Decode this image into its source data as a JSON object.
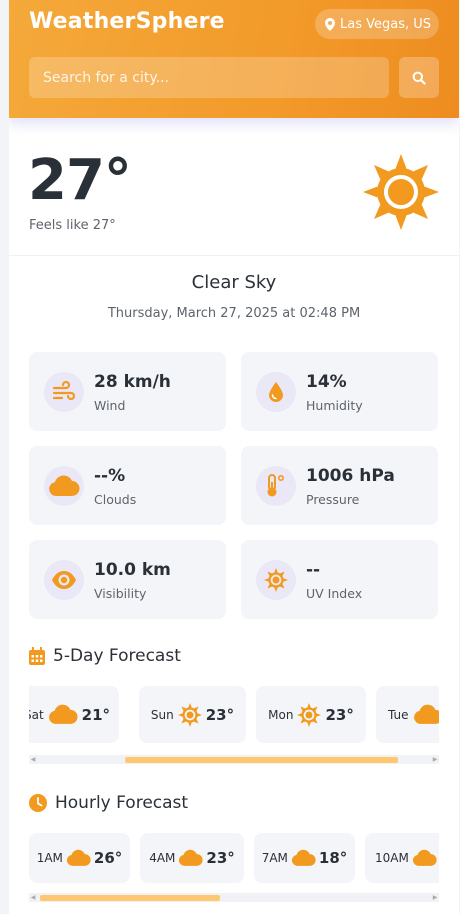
{
  "header": {
    "app_title": "WeatherSphere",
    "location": "Las Vegas, US",
    "search_placeholder": "Search for a city..."
  },
  "current": {
    "temperature": "27°",
    "feels_like": "Feels like 27°",
    "condition": "Clear Sky",
    "datetime": "Thursday, March 27, 2025 at 02:48 PM",
    "icon": "sun-icon"
  },
  "stats": [
    {
      "value": "28 km/h",
      "label": "Wind",
      "icon": "wind-icon"
    },
    {
      "value": "14%",
      "label": "Humidity",
      "icon": "droplet-icon"
    },
    {
      "value": "--%",
      "label": "Clouds",
      "icon": "cloud-icon"
    },
    {
      "value": "1006 hPa",
      "label": "Pressure",
      "icon": "thermometer-icon"
    },
    {
      "value": "10.0 km",
      "label": "Visibility",
      "icon": "eye-icon"
    },
    {
      "value": "--",
      "label": "UV Index",
      "icon": "sun-icon"
    }
  ],
  "forecast": {
    "title": "5-Day Forecast",
    "days": [
      {
        "day": "Sat",
        "temp": "21°",
        "icon": "cloud-icon"
      },
      {
        "day": "Sun",
        "temp": "23°",
        "icon": "sun-icon"
      },
      {
        "day": "Mon",
        "temp": "23°",
        "icon": "sun-icon"
      },
      {
        "day": "Tue",
        "temp": "",
        "icon": "cloud-icon"
      }
    ]
  },
  "hourly": {
    "title": "Hourly Forecast",
    "hours": [
      {
        "time": "1AM",
        "temp": "26°",
        "icon": "cloud-icon"
      },
      {
        "time": "4AM",
        "temp": "23°",
        "icon": "cloud-icon"
      },
      {
        "time": "7AM",
        "temp": "18°",
        "icon": "cloud-icon"
      },
      {
        "time": "10AM",
        "temp": "",
        "icon": "cloud-icon"
      }
    ]
  },
  "colors": {
    "accent": "#f29a2a",
    "card_bg": "#f4f5f9",
    "icon_bg": "#eae7f6",
    "scroll_thumb": "#ffc870"
  }
}
